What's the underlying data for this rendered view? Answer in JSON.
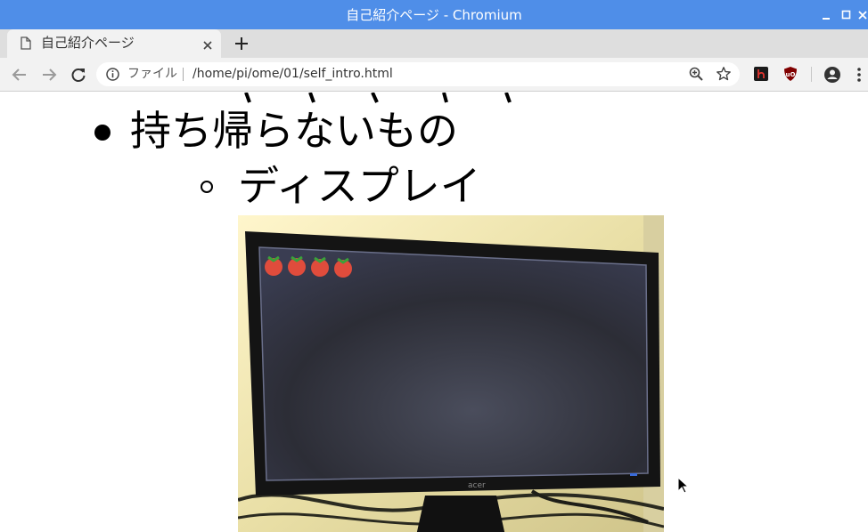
{
  "window": {
    "title": "自己紹介ページ - Chromium"
  },
  "tab": {
    "title": "自己紹介ページ"
  },
  "toolbar": {
    "scheme_label": "ファイル",
    "url": "/home/pi/ome/01/self_intro.html"
  },
  "page": {
    "list_item_1": "持ち帰らないもの",
    "list_item_2": "ディスプレイ",
    "photo": {
      "brand_label": "acer",
      "raspberry_logo_count": 4
    }
  },
  "colors": {
    "titlebar": "#4f8ee8",
    "tabstrip": "#dedede",
    "toolbar": "#f2f2f2"
  }
}
